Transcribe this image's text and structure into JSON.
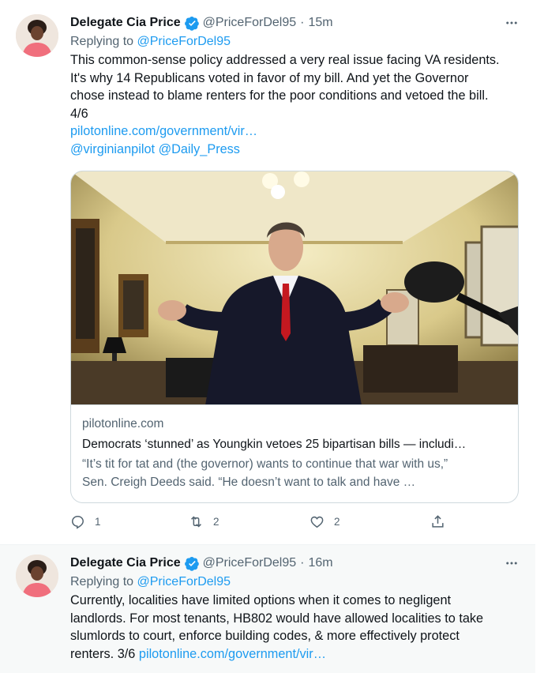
{
  "tweets": [
    {
      "author_name": "Delegate Cia Price",
      "handle": "@PriceForDel95",
      "separator": "·",
      "time": "15m",
      "replying_to_label": "Replying to",
      "replying_to_handle": "@PriceForDel95",
      "text_line1": "This common-sense policy addressed a very real issue facing VA residents.",
      "text_line2": "It's why 14 Republicans voted in favor of my bill. And yet the Governor",
      "text_line3": "chose instead to blame renters for the poor conditions and vetoed the bill.",
      "text_line4": "4/6",
      "link": "pilotonline.com/government/vir…",
      "mention1": "@virginianpilot",
      "mention2": "@Daily_Press",
      "card": {
        "domain": "pilotonline.com",
        "title": "Democrats ‘stunned’ as Youngkin vetoes 25 bipartisan bills — includi…",
        "desc_line1": "“It’s tit for tat and (the governor) wants to continue that war with us,”",
        "desc_line2": "Sen. Creigh Deeds said. “He doesn’t want to talk and have …"
      },
      "actions": {
        "reply_count": "1",
        "retweet_count": "2",
        "like_count": "2"
      }
    },
    {
      "author_name": "Delegate Cia Price",
      "handle": "@PriceForDel95",
      "separator": "·",
      "time": "16m",
      "replying_to_label": "Replying to",
      "replying_to_handle": "@PriceForDel95",
      "text_line1": "Currently, localities have limited options when it comes to negligent",
      "text_line2": "landlords. For most tenants, HB802 would have allowed localities to take",
      "text_line3": "slumlords to court, enforce building codes, & more effectively protect",
      "text_line4": "renters. 3/6",
      "link": "pilotonline.com/government/vir…"
    }
  ],
  "icons": {
    "more": "more-icon",
    "verified": "verified-badge-icon",
    "reply": "reply-icon",
    "retweet": "retweet-icon",
    "like": "like-icon",
    "share": "share-icon"
  },
  "colors": {
    "accent": "#1d9bf0",
    "text": "#0f1419",
    "secondary": "#536471",
    "border": "#cfd9de",
    "hover_bg": "#f7f9f9"
  }
}
